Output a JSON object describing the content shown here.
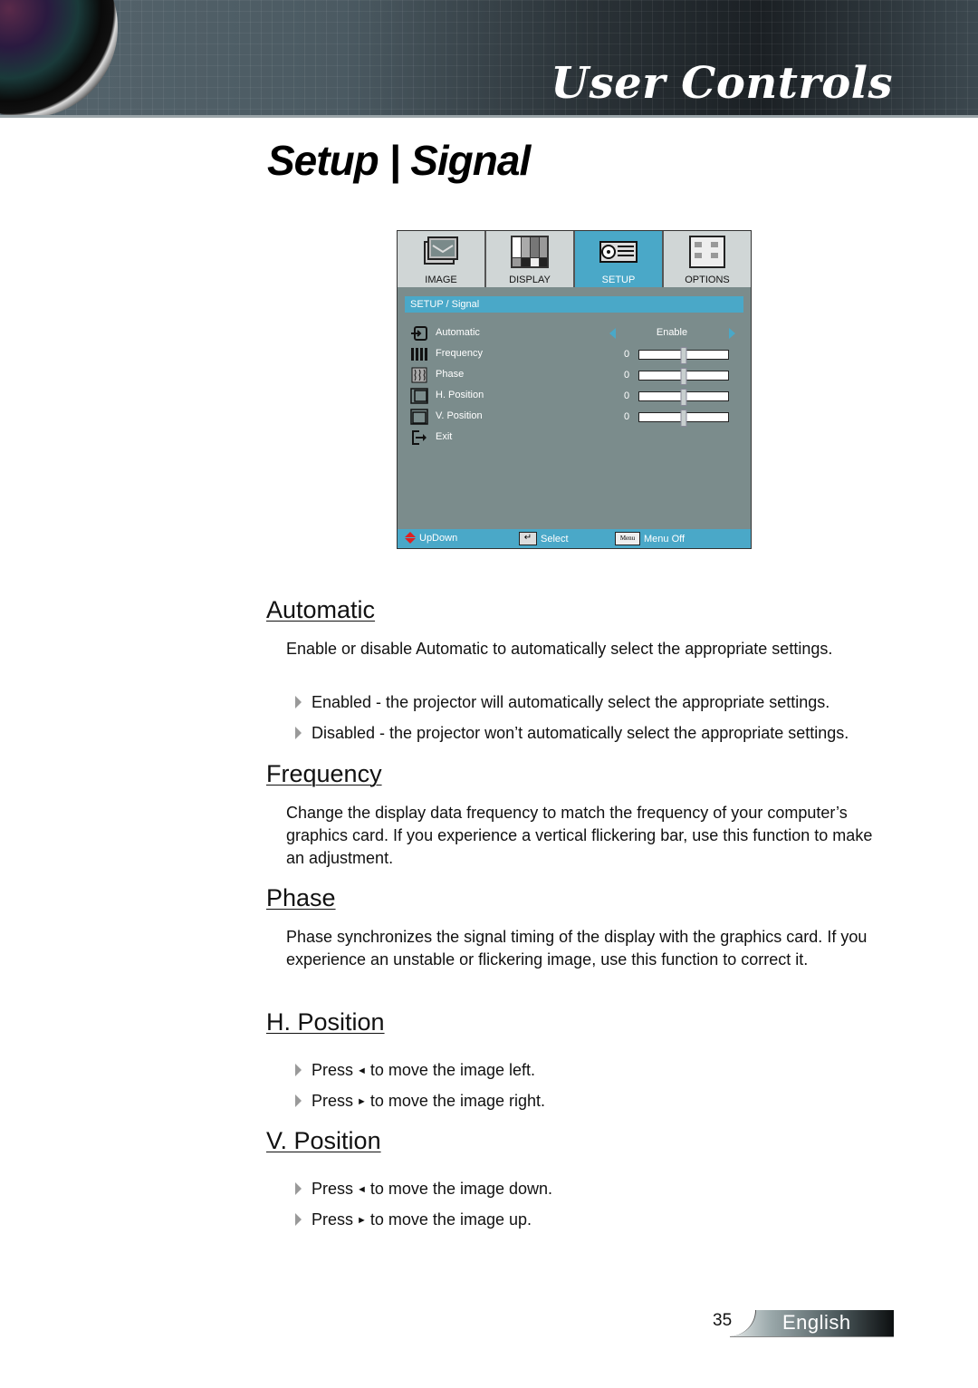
{
  "header": {
    "section_title": "User Controls"
  },
  "page_title": "Setup | Signal",
  "osd": {
    "tabs": [
      {
        "label": "IMAGE",
        "icon": "image-icon",
        "active": false
      },
      {
        "label": "DISPLAY",
        "icon": "display-icon",
        "active": false
      },
      {
        "label": "SETUP",
        "icon": "projector-icon",
        "active": true
      },
      {
        "label": "OPTIONS",
        "icon": "options-icon",
        "active": false
      }
    ],
    "breadcrumb": "SETUP / Signal",
    "rows": [
      {
        "label": "Automatic",
        "icon": "input-icon",
        "value": "Enable"
      },
      {
        "label": "Frequency",
        "icon": "frequency-icon",
        "value": "0",
        "slider": 0.5
      },
      {
        "label": "Phase",
        "icon": "phase-icon",
        "value": "0",
        "slider": 0.5
      },
      {
        "label": "H. Position",
        "icon": "h-position-icon",
        "value": "0",
        "slider": 0.5
      },
      {
        "label": "V. Position",
        "icon": "v-position-icon",
        "value": "0",
        "slider": 0.5
      },
      {
        "label": "Exit",
        "icon": "exit-icon"
      }
    ],
    "footer": {
      "updown": "UpDown",
      "select": "Select",
      "menu_key": "Menu",
      "menu_off": "Menu Off"
    },
    "colors": {
      "accent": "#4aa8c8",
      "panel": "#7b8c8c"
    }
  },
  "sections": {
    "automatic": {
      "heading": "Automatic",
      "text": "Enable or disable Automatic to automatically select the appropriate settings.",
      "bullets": [
        "Enabled - the projector will automatically select the appropriate settings.",
        "Disabled - the projector won’t automatically select the appropriate settings."
      ]
    },
    "frequency": {
      "heading": "Frequency",
      "text": "Change the display data frequency to match the frequency of your computer’s graphics card. If you experience a vertical flickering bar, use this function to make an adjustment."
    },
    "phase": {
      "heading": "Phase",
      "text": "Phase synchronizes the signal timing of the display with the graphics card. If you experience an unstable or flickering image, use this function to correct it."
    },
    "h_position": {
      "heading": "H. Position",
      "bullets": [
        {
          "pre": "Press",
          "symbol": "◄",
          "post": "to move the image left."
        },
        {
          "pre": "Press",
          "symbol": "►",
          "post": "to move the image right."
        }
      ]
    },
    "v_position": {
      "heading": "V. Position",
      "bullets": [
        {
          "pre": "Press",
          "symbol": "◄",
          "post": "to move the image down."
        },
        {
          "pre": "Press",
          "symbol": "►",
          "post": "to move the image up."
        }
      ]
    }
  },
  "footer": {
    "page_number": "35",
    "language": "English"
  }
}
